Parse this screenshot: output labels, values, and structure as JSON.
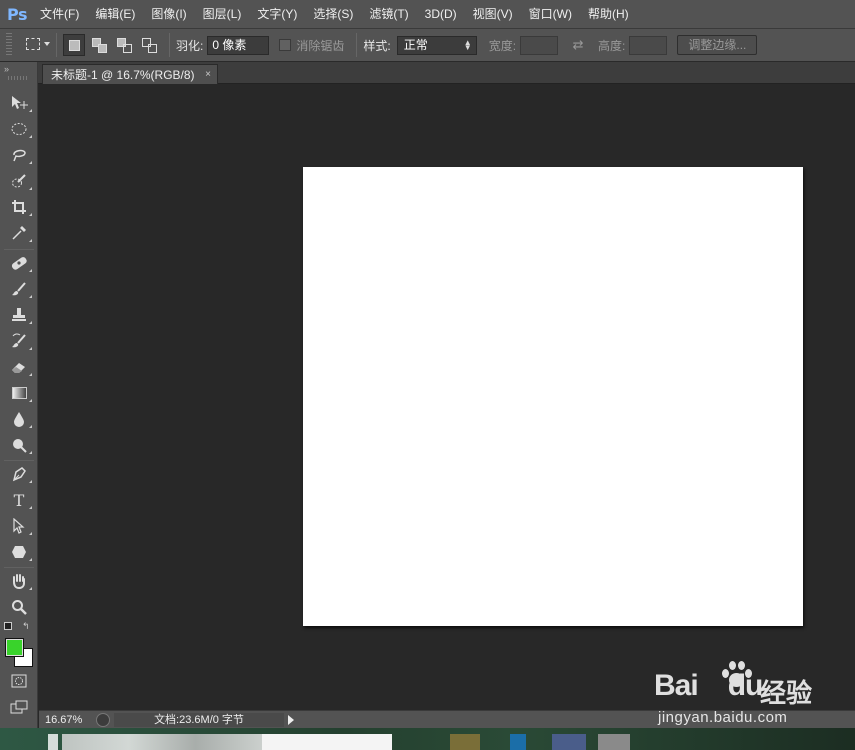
{
  "app": {
    "logo": "Ps"
  },
  "menu": [
    "文件(F)",
    "编辑(E)",
    "图像(I)",
    "图层(L)",
    "文字(Y)",
    "选择(S)",
    "滤镜(T)",
    "3D(D)",
    "视图(V)",
    "窗口(W)",
    "帮助(H)"
  ],
  "options": {
    "feather_label": "羽化:",
    "feather_value": "0 像素",
    "antialias_label": "消除锯齿",
    "style_label": "样式:",
    "style_value": "正常",
    "width_label": "宽度:",
    "height_label": "高度:",
    "refine_edge_label": "调整边缘..."
  },
  "document_tab": {
    "title": "未标题-1 @ 16.7%(RGB/8)",
    "close": "×"
  },
  "status": {
    "zoom": "16.67%",
    "doc_info": "文档:23.6M/0 字节"
  },
  "colors": {
    "foreground": "#39d32b",
    "background": "#ffffff"
  },
  "watermark": {
    "brand": "Bai",
    "brand_tail": "du",
    "cn": "经验",
    "url": "jingyan.baidu.com"
  },
  "tools": [
    "move-tool",
    "rect-marquee-tool",
    "lasso-tool",
    "quick-selection-tool",
    "crop-tool",
    "eyedropper-tool",
    "healing-brush-tool",
    "brush-tool",
    "clone-stamp-tool",
    "history-brush-tool",
    "eraser-tool",
    "gradient-tool",
    "blur-tool",
    "dodge-tool",
    "pen-tool",
    "type-tool",
    "path-selection-tool",
    "shape-tool",
    "hand-tool",
    "zoom-tool"
  ]
}
